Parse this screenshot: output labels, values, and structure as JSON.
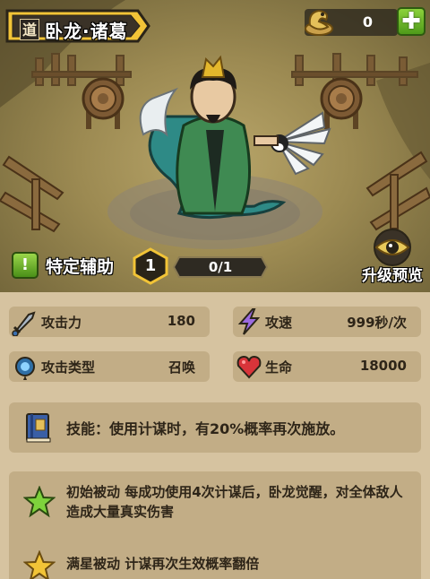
{
  "header": {
    "tag": "道",
    "hero_name": "卧龙·诸葛",
    "currency_icon": "dragon-coin-icon",
    "currency_value": "0",
    "add_label": "✚"
  },
  "hero": {
    "role_icon": "exclamation-icon",
    "role_label": "特定辅助",
    "level": "1",
    "progress_text": "0/1",
    "progress_fraction": 0,
    "upgrade_preview_label": "升级预览"
  },
  "stats": [
    {
      "icon": "sword-icon",
      "label": "攻击力",
      "value": "180"
    },
    {
      "icon": "lightning-icon",
      "label": "攻速",
      "value": "999秒/次"
    },
    {
      "icon": "summon-orb-icon",
      "label": "攻击类型",
      "value": "召唤"
    },
    {
      "icon": "heart-icon",
      "label": "生命",
      "value": "18000"
    }
  ],
  "skill": {
    "icon": "book-icon",
    "text": "技能：使用计谋时，有20%概率再次施放。"
  },
  "passives": [
    {
      "icon": "green-star-icon",
      "text": "初始被动 每成功使用4次计谋后，卧龙觉醒，对全体敌人造成大量真实伤害"
    },
    {
      "icon": "gold-star-icon",
      "text": "满星被动 计谋再次生效概率翻倍"
    }
  ],
  "colors": {
    "panel_bg": "#d6c3a0",
    "card_bg": "#c2ad86",
    "text_dark": "#2e2518",
    "title_banner": "#f2c437",
    "add_button": "#6fb52a"
  }
}
